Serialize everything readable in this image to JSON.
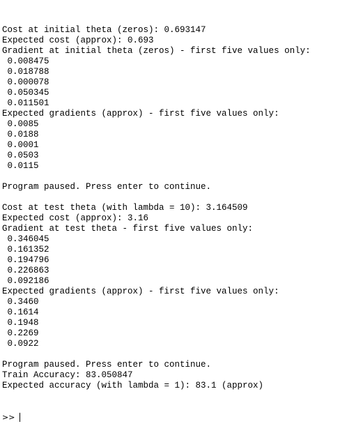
{
  "console": {
    "lines": [
      "Cost at initial theta (zeros): 0.693147",
      "Expected cost (approx): 0.693",
      "Gradient at initial theta (zeros) - first five values only:",
      " 0.008475",
      " 0.018788",
      " 0.000078",
      " 0.050345",
      " 0.011501",
      "Expected gradients (approx) - first five values only:",
      " 0.0085",
      " 0.0188",
      " 0.0001",
      " 0.0503",
      " 0.0115",
      "",
      "Program paused. Press enter to continue.",
      "",
      "Cost at test theta (with lambda = 10): 3.164509",
      "Expected cost (approx): 3.16",
      "Gradient at test theta - first five values only:",
      " 0.346045",
      " 0.161352",
      " 0.194796",
      " 0.226863",
      " 0.092186",
      "Expected gradients (approx) - first five values only:",
      " 0.3460",
      " 0.1614",
      " 0.1948",
      " 0.2269",
      " 0.0922",
      "",
      "Program paused. Press enter to continue.",
      "Train Accuracy: 83.050847",
      "Expected accuracy (with lambda = 1): 83.1 (approx)"
    ],
    "prompt": ">>"
  }
}
